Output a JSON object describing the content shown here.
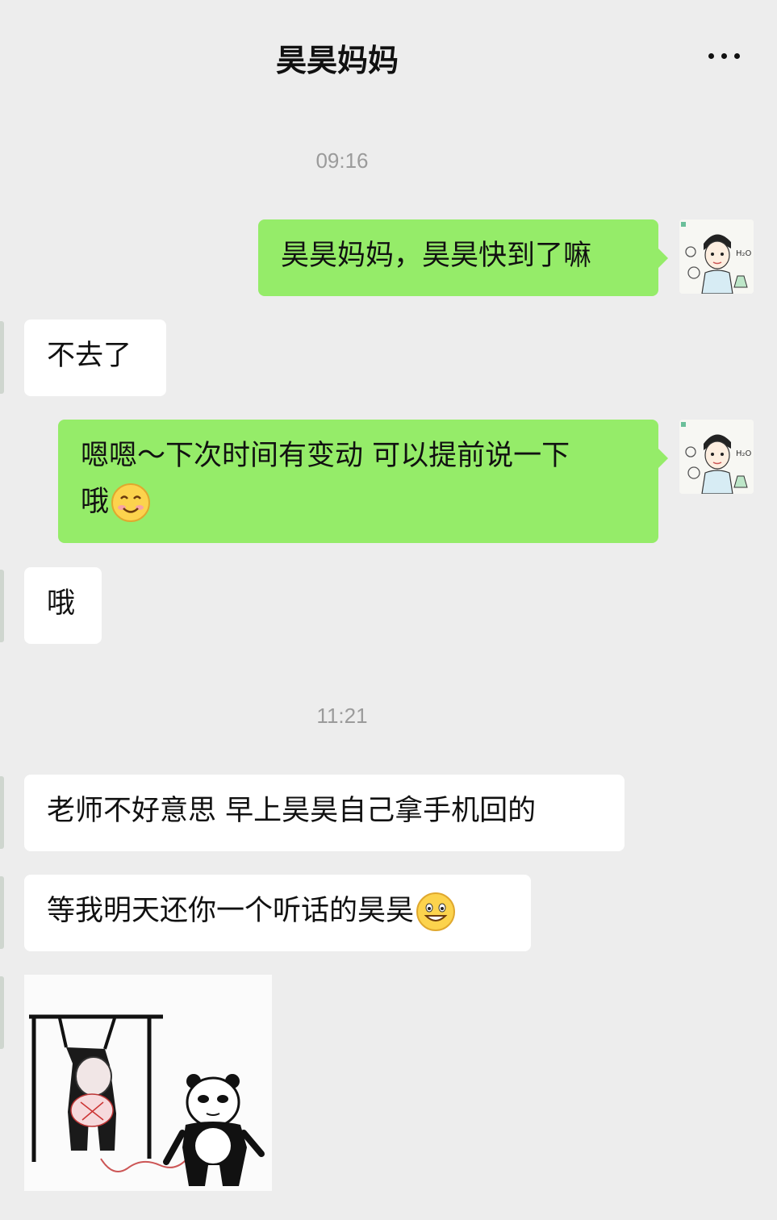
{
  "header": {
    "title": "昊昊妈妈",
    "more_icon": "more-horizontal-icon"
  },
  "messages": [
    {
      "type": "time",
      "text": "09:16"
    },
    {
      "type": "out",
      "text": "昊昊妈妈，昊昊快到了嘛"
    },
    {
      "type": "in",
      "text": "不去了"
    },
    {
      "type": "out",
      "text_line1": "嗯嗯～下次时间有变动 可以提前说一下",
      "text_line2": "哦",
      "emoji": "smile-emoji-icon"
    },
    {
      "type": "in",
      "text": "哦"
    },
    {
      "type": "time",
      "text": "11:21"
    },
    {
      "type": "in",
      "text": "老师不好意思 早上昊昊自己拿手机回的"
    },
    {
      "type": "in",
      "text": "等我明天还你一个听话的昊昊",
      "emoji": "grin-emoji-icon"
    },
    {
      "type": "in-sticker",
      "sticker": "panda-meme-sticker"
    }
  ],
  "colors": {
    "outgoing_bubble": "#95ec69",
    "incoming_bubble": "#ffffff",
    "background": "#ededed"
  }
}
